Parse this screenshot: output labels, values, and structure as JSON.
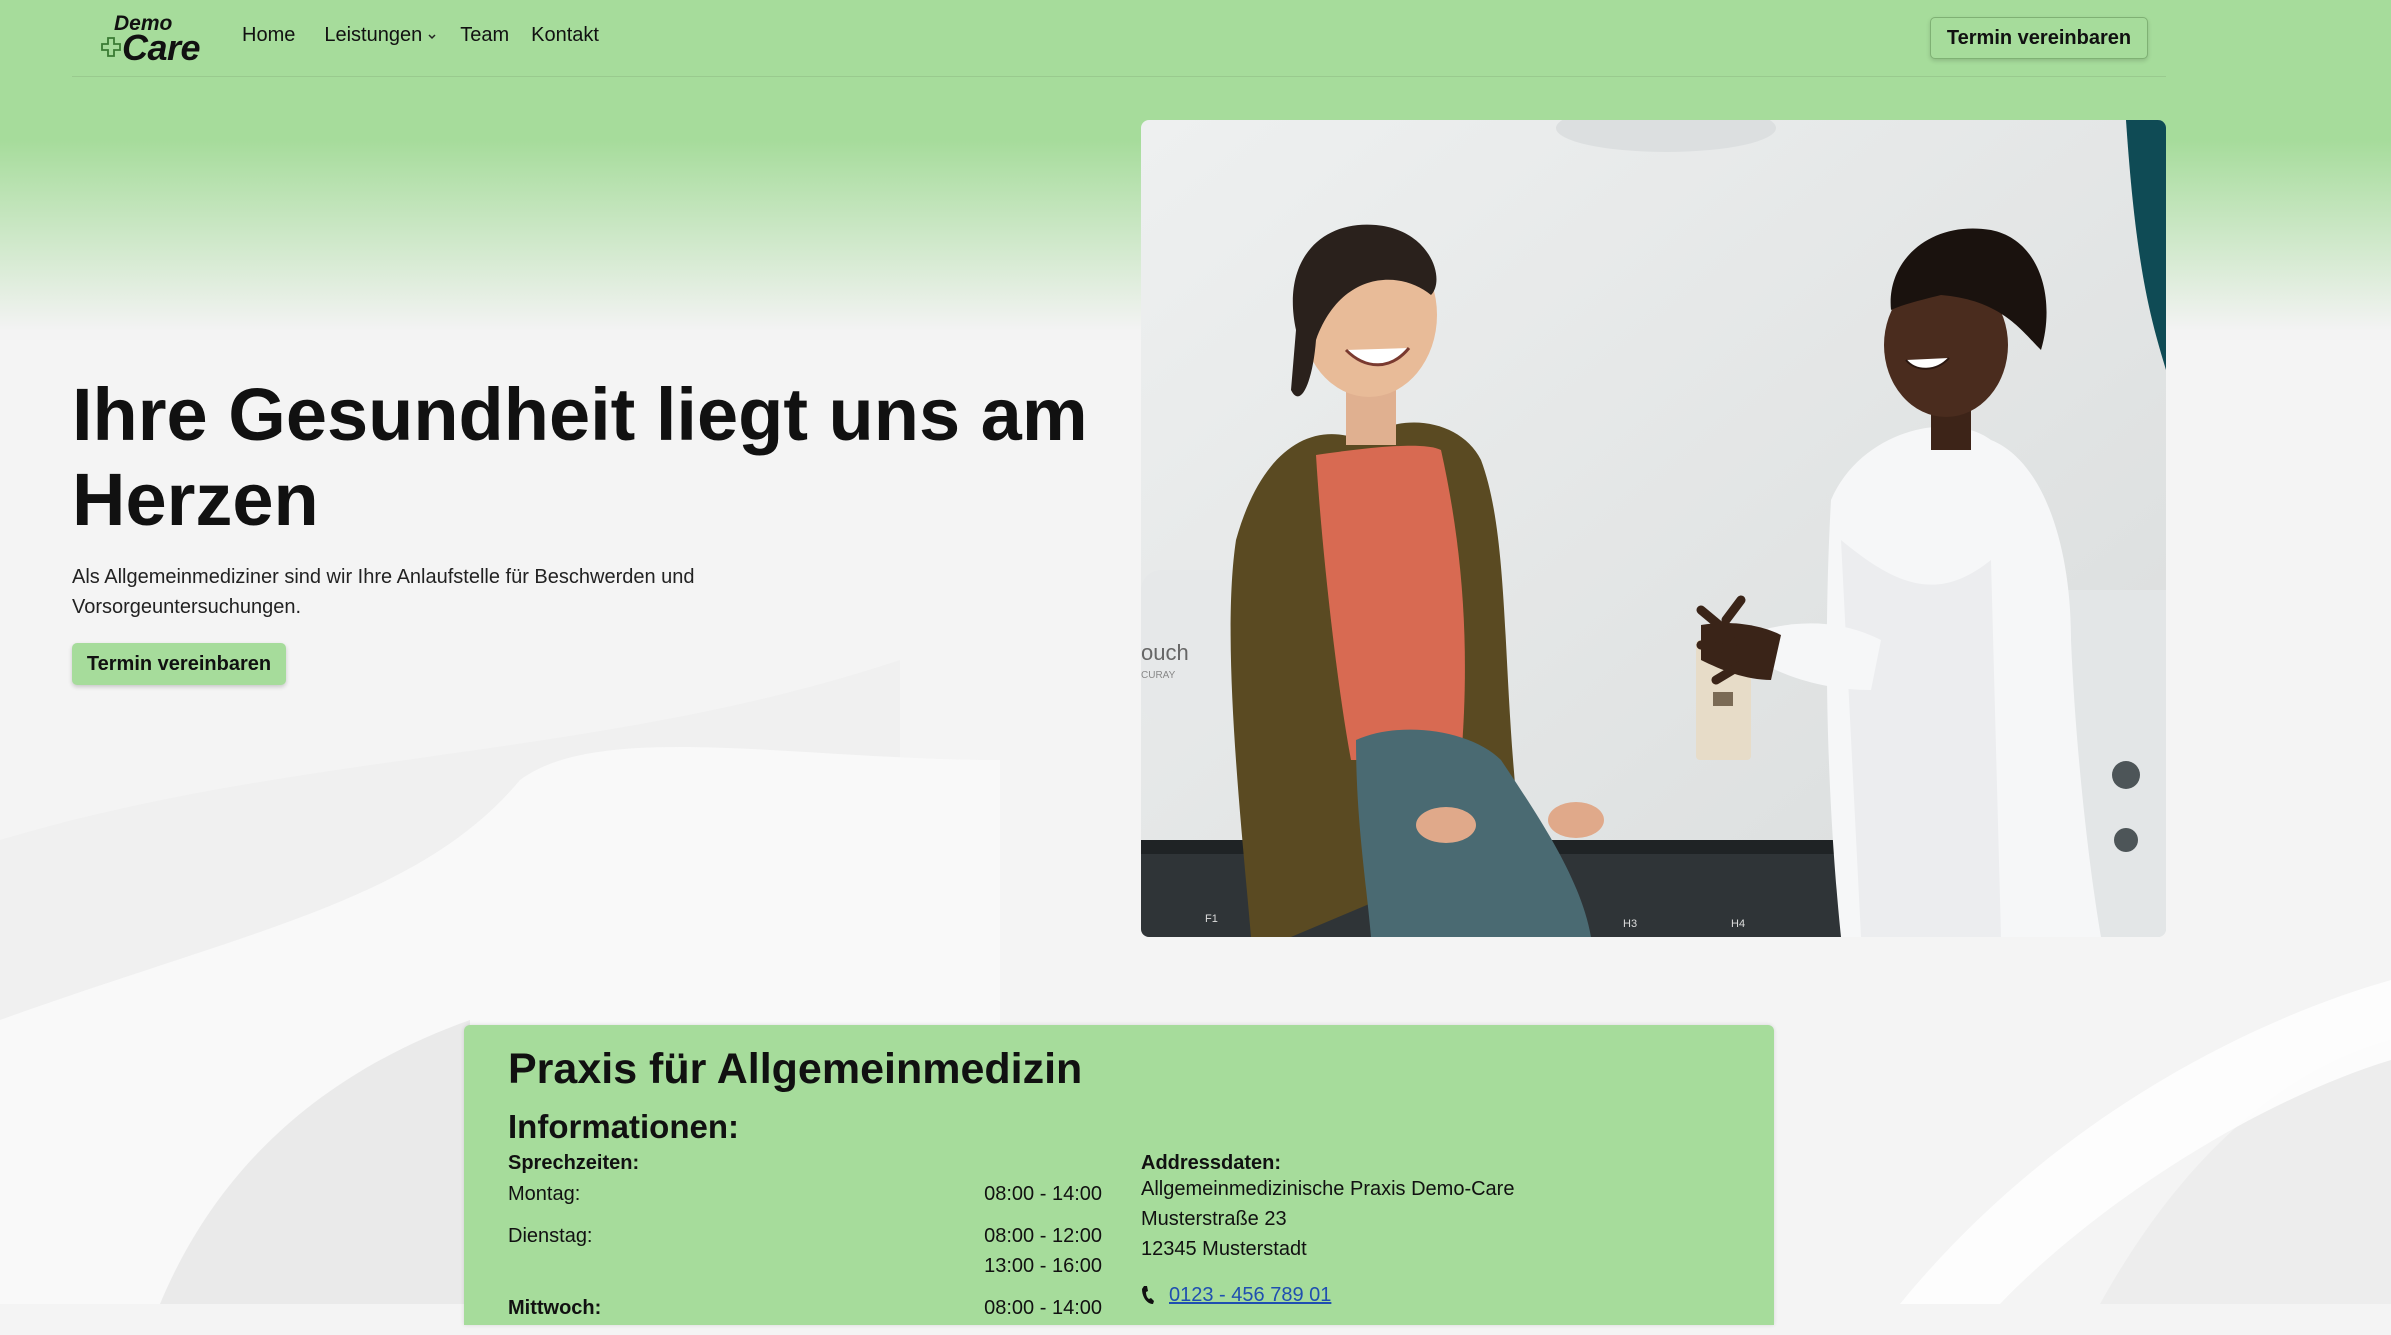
{
  "logo": {
    "top": "Demo",
    "bottom": "Care"
  },
  "nav": {
    "home": "Home",
    "leistungen": "Leistungen",
    "team": "Team",
    "kontakt": "Kontakt",
    "cta": "Termin vereinbaren"
  },
  "hero": {
    "title": "Ihre Gesundheit liegt uns am Herzen",
    "subtitle": "Als Allgemeinmediziner sind wir Ihre Anlaufstelle für Beschwerden und Vorsorgeuntersuchungen.",
    "cta": "Termin vereinbaren",
    "image_labels": {
      "machine": "ouch",
      "machine_small": "CURAY",
      "f1": "F1",
      "h3": "H3",
      "h4": "H4"
    }
  },
  "card": {
    "title": "Praxis für Allgemeinmedizin",
    "info_title": "Informationen:",
    "hours_title": "Sprechzeiten:",
    "hours": [
      {
        "day": "Montag:",
        "time1": "08:00 - 14:00",
        "time2": ""
      },
      {
        "day": "Dienstag:",
        "time1": "08:00 - 12:00",
        "time2": "13:00 - 16:00"
      },
      {
        "day": "Mittwoch:",
        "time1": "08:00 - 14:00",
        "time2": ""
      }
    ],
    "address_title": "Addressdaten:",
    "address": [
      "Allgemeinmedizinische Praxis Demo-Care",
      "Musterstraße 23",
      "12345 Musterstadt"
    ],
    "phone": "0123 - 456 789 01"
  },
  "colors": {
    "brand_green": "#a6dc9b",
    "link_blue": "#1f4fb0",
    "text": "#111111"
  },
  "icons": [
    "medical-cross-icon",
    "chevron-down-icon",
    "phone-icon"
  ]
}
